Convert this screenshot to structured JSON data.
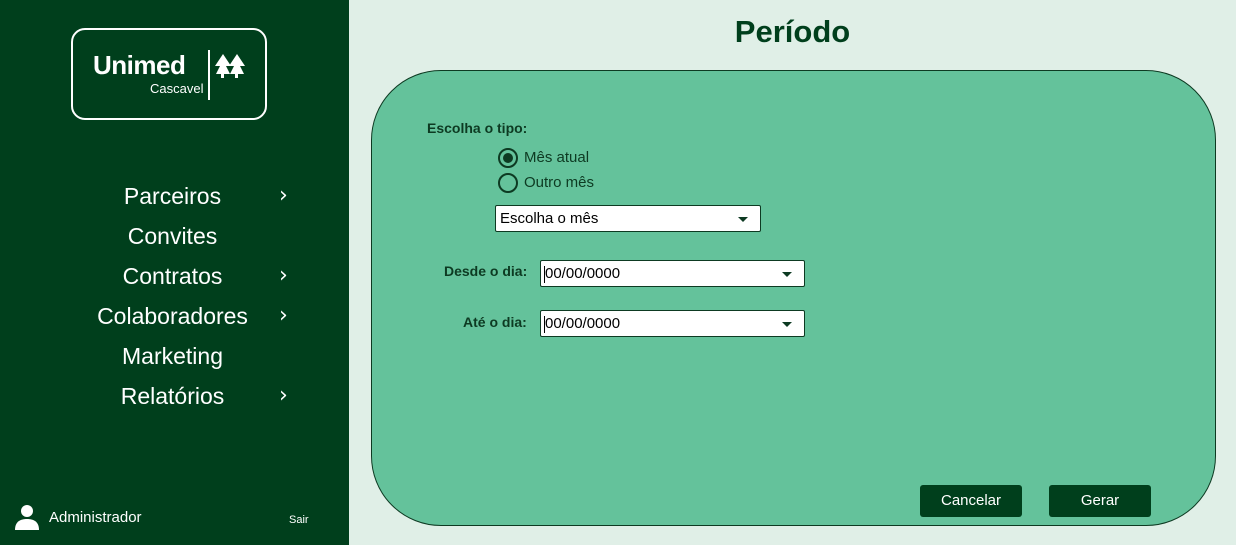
{
  "brand": {
    "name": "Unimed",
    "location": "Cascavel"
  },
  "sidebar": {
    "items": [
      {
        "label": "Parceiros",
        "has_submenu": true
      },
      {
        "label": "Convites",
        "has_submenu": false
      },
      {
        "label": "Contratos",
        "has_submenu": true
      },
      {
        "label": "Colaboradores",
        "has_submenu": true
      },
      {
        "label": "Marketing",
        "has_submenu": false
      },
      {
        "label": "Relatórios",
        "has_submenu": true
      }
    ],
    "chevron": "›",
    "user": {
      "name": "Administrador",
      "icon": "user-icon"
    },
    "logout_label": "Sair"
  },
  "page": {
    "title": "Período"
  },
  "form": {
    "type_label": "Escolha o tipo:",
    "radios": [
      {
        "label": "Mês atual",
        "selected": true
      },
      {
        "label": "Outro mês",
        "selected": false
      }
    ],
    "month_select": {
      "value": "Escolha o mês"
    },
    "from_label": "Desde o dia:",
    "from_value": "00/00/0000",
    "to_label": "Até o dia:",
    "to_value": "00/00/0000"
  },
  "actions": {
    "cancel_label": "Cancelar",
    "generate_label": "Gerar"
  },
  "colors": {
    "sidebar_bg": "#003f1c",
    "page_bg": "#e0efe7",
    "panel_bg": "#64c29b",
    "accent": "#0d3a22"
  }
}
